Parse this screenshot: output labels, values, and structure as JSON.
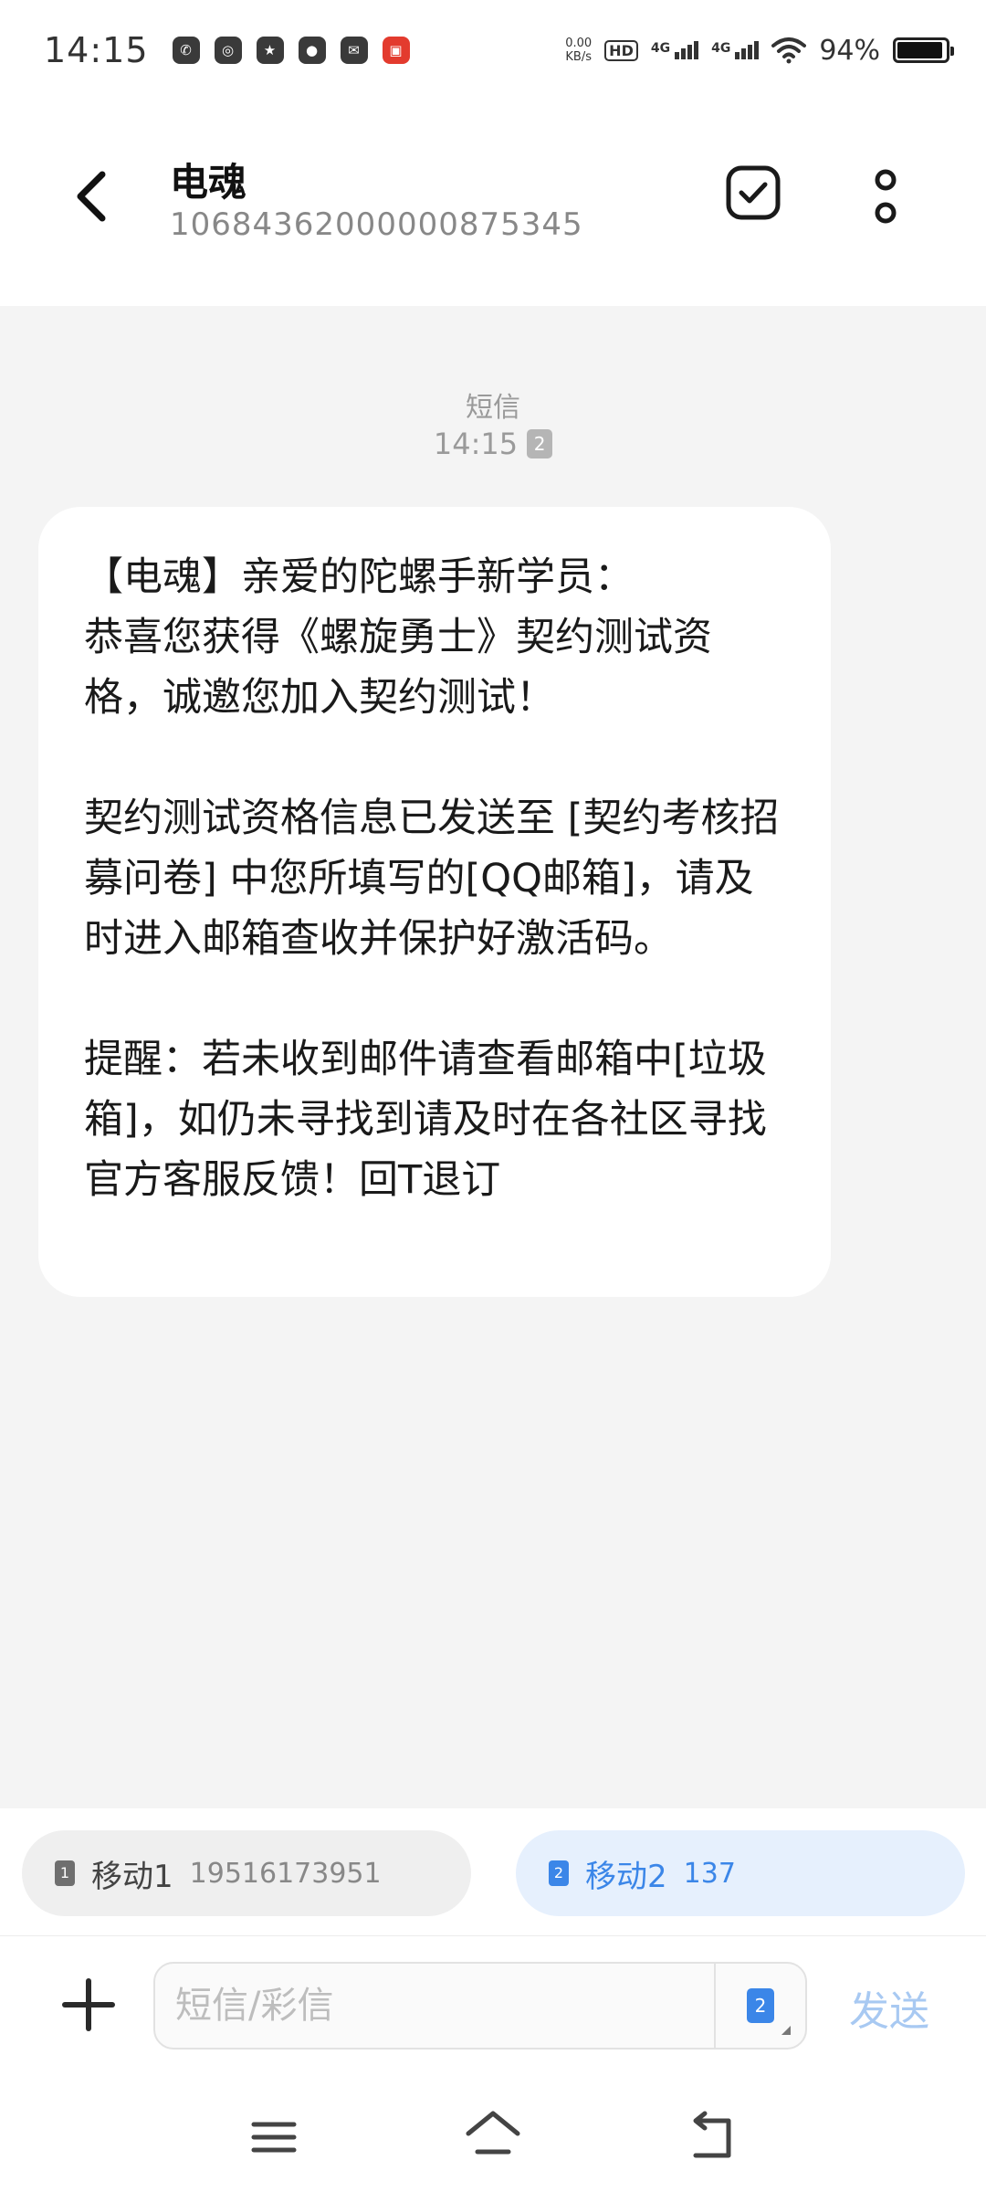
{
  "status_bar": {
    "time": "14:15",
    "notification_icons": [
      "wechat-icon",
      "chat-bubble-icon",
      "star-flag-icon",
      "du-location-icon",
      "mail-icon",
      "news-app-icon"
    ],
    "net_speed_value": "0.00",
    "net_speed_unit": "KB/s",
    "hd_label": "HD",
    "network_1": "4G",
    "network_2": "4G",
    "battery_percent": "94%",
    "battery_level": 0.94
  },
  "header": {
    "title": "电魂",
    "number": "10684362000000875345"
  },
  "conversation": {
    "message_type": "短信",
    "message_time": "14:15",
    "sim_badge": "2",
    "message_paragraphs": [
      "【电魂】亲爱的陀螺手新学员：\n恭喜您获得《螺旋勇士》契约测试资格，诚邀您加入契约测试！",
      "契约测试资格信息已发送至 [契约考核招募问卷] 中您所填写的[QQ邮箱]，请及时进入邮箱查收并保护好激活码。",
      "提醒：若未收到邮件请查看邮箱中[垃圾箱]，如仍未寻找到请及时在各社区寻找官方客服反馈！回T退订"
    ]
  },
  "sim_selector": {
    "sim1": {
      "badge": "1",
      "name": "移动1",
      "number": "19516173951"
    },
    "sim2": {
      "badge": "2",
      "name": "移动2",
      "number": "137"
    }
  },
  "compose": {
    "placeholder": "短信/彩信",
    "sim_badge": "2",
    "send_label": "发送"
  },
  "colors": {
    "accent": "#3b86e8",
    "send_disabled": "#a8c9f2",
    "background": "#f4f4f4"
  }
}
